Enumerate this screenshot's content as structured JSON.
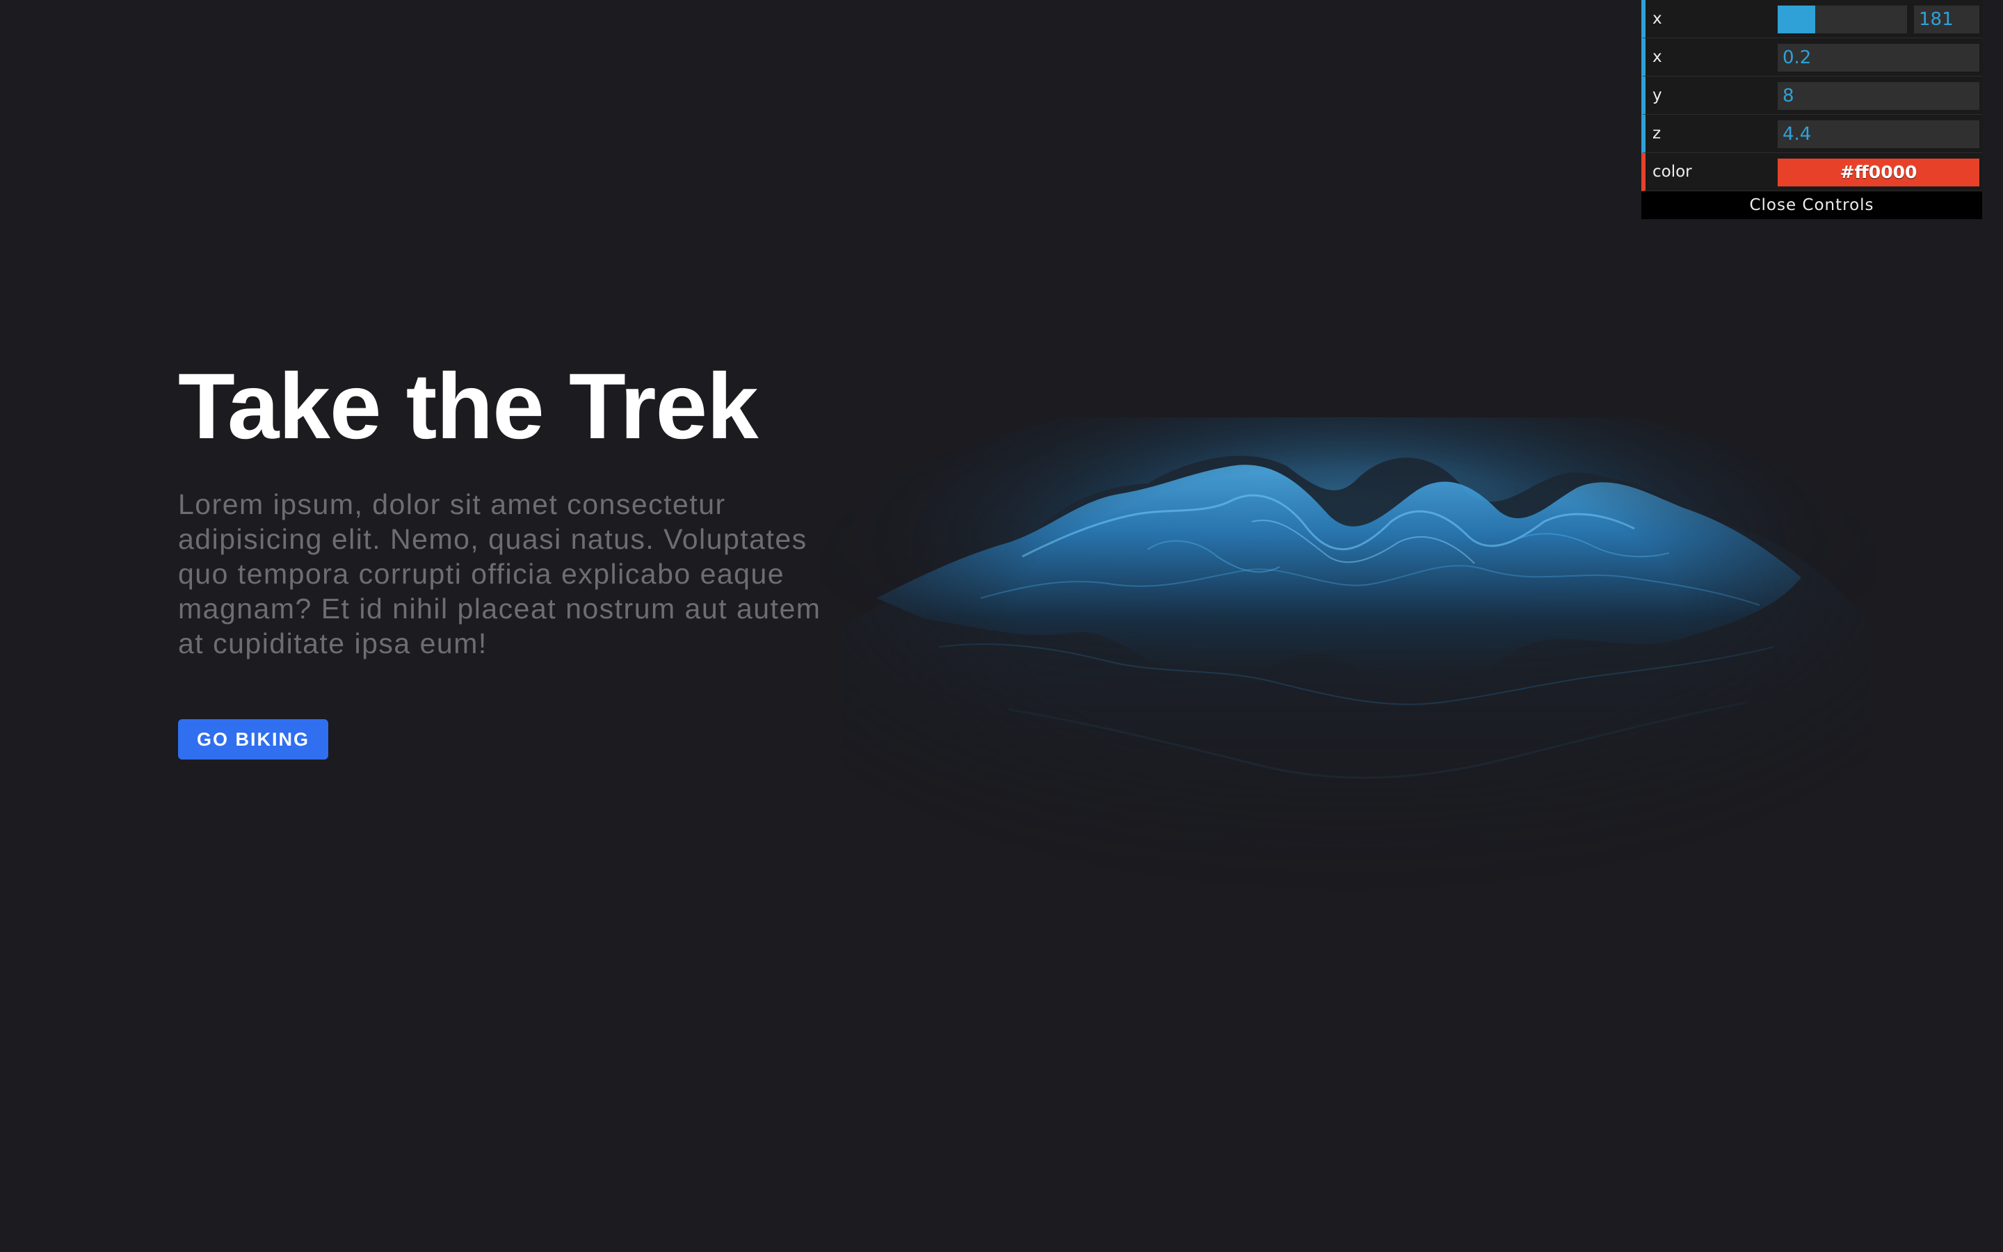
{
  "hero": {
    "title": "Take the Trek",
    "body": "Lorem ipsum, dolor sit amet consectetur adipisicing elit. Nemo, quasi natus. Voluptates quo tempora corrupti officia explicabo eaque magnam? Et id nihil placeat nostrum aut autem at cupiditate ipsa eum!",
    "cta_label": "GO BIKING",
    "cta_color": "#2f6ff0"
  },
  "controls": {
    "rows": [
      {
        "label": "x",
        "type": "slider",
        "value": "181",
        "fill_fraction": 0.29
      },
      {
        "label": "x",
        "type": "number",
        "value": "0.2"
      },
      {
        "label": "y",
        "type": "number",
        "value": "8"
      },
      {
        "label": "z",
        "type": "number",
        "value": "4.4"
      },
      {
        "label": "color",
        "type": "color",
        "value": "#ff0000",
        "swatch": "#e8412a"
      }
    ],
    "close_label": "Close Controls",
    "accent": "#2fa1d6"
  },
  "colors": {
    "background": "#1b1b20",
    "terrain": "#2a8fd8"
  }
}
